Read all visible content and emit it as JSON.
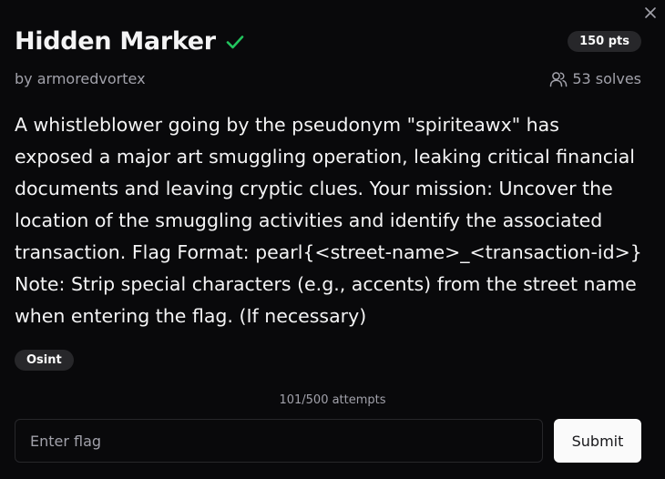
{
  "challenge": {
    "title": "Hidden Marker",
    "points": "150 pts",
    "author": "by armoredvortex",
    "solves": "53 solves",
    "description": "A whistleblower going by the pseudonym \"spiriteawx\" has exposed a major art smuggling operation, leaking critical financial documents and leaving cryptic clues. Your mission: Uncover the location of the smuggling activities and identify the associated transaction. Flag Format: pearl{<street-name>_<transaction-id>} Note: Strip special characters (e.g., accents) from the street name when entering the flag. (If necessary)",
    "tag": "Osint",
    "attempts": "101/500 attempts"
  },
  "form": {
    "flag_placeholder": "Enter flag",
    "flag_value": "",
    "submit_label": "Submit"
  },
  "icons": {
    "close": "close-icon",
    "solved": "check-icon",
    "solvers": "users-icon"
  },
  "colors": {
    "background": "#09090b",
    "check": "#22c55e",
    "badge": "#27272a",
    "muted_text": "#a1a1aa",
    "submit_bg": "#fafafa"
  }
}
